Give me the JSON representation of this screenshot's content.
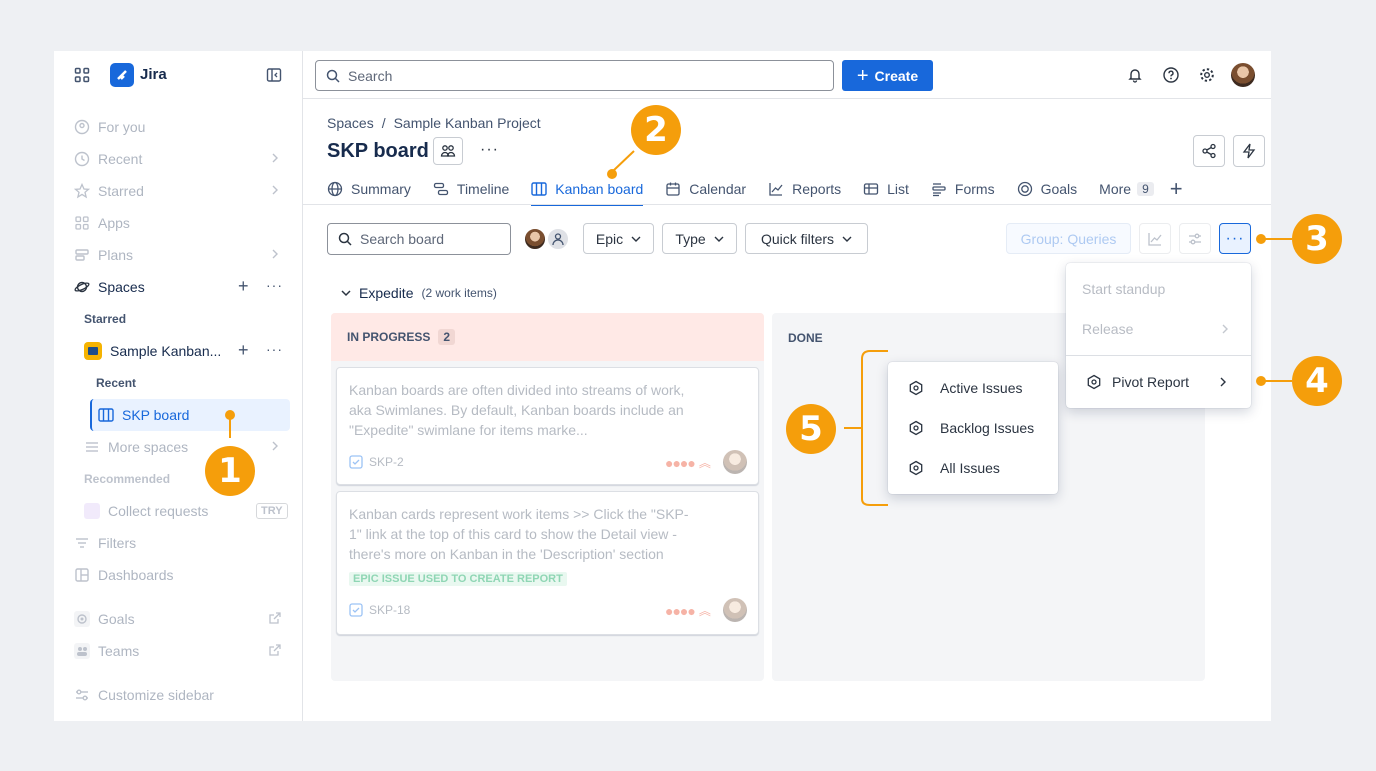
{
  "sidebar": {
    "app_name": "Jira",
    "items": [
      {
        "label": "For you"
      },
      {
        "label": "Recent"
      },
      {
        "label": "Starred"
      },
      {
        "label": "Apps"
      },
      {
        "label": "Plans"
      }
    ],
    "spaces_label": "Spaces",
    "starred_label": "Starred",
    "project_name": "Sample Kanban...",
    "recent_label": "Recent",
    "current_board": "SKP board",
    "more_spaces": "More spaces",
    "recommended_label": "Recommended",
    "collect_requests": "Collect requests",
    "try_badge": "TRY",
    "filters": "Filters",
    "dashboards": "Dashboards",
    "goals": "Goals",
    "teams": "Teams",
    "customize": "Customize sidebar"
  },
  "topbar": {
    "search_placeholder": "Search",
    "create_label": "Create"
  },
  "header": {
    "breadcrumb_spaces": "Spaces",
    "breadcrumb_sep": "/",
    "breadcrumb_project": "Sample Kanban Project",
    "title": "SKP board",
    "more": "···"
  },
  "tabs": [
    {
      "label": "Summary",
      "icon": "globe-icon"
    },
    {
      "label": "Timeline",
      "icon": "timeline-icon"
    },
    {
      "label": "Kanban board",
      "icon": "board-icon"
    },
    {
      "label": "Calendar",
      "icon": "calendar-icon"
    },
    {
      "label": "Reports",
      "icon": "chart-icon"
    },
    {
      "label": "List",
      "icon": "list-icon"
    },
    {
      "label": "Forms",
      "icon": "forms-icon"
    },
    {
      "label": "Goals",
      "icon": "target-icon"
    }
  ],
  "tabs_more": {
    "label": "More",
    "count": "9"
  },
  "toolbar": {
    "search_board_placeholder": "Search board",
    "epic": "Epic",
    "type": "Type",
    "quick_filters": "Quick filters",
    "group": "Group: Queries"
  },
  "swimlane": {
    "name": "Expedite",
    "count": "(2 work items)"
  },
  "columns": {
    "in_progress": {
      "label": "IN PROGRESS",
      "count": "2"
    },
    "done": {
      "label": "DONE"
    }
  },
  "cards": [
    {
      "text": "Kanban boards are often divided into streams of work, aka Swimlanes. By default, Kanban boards include an \"Expedite\" swimlane for items marke...",
      "key": "SKP-2"
    },
    {
      "text": "Kanban cards represent work items >> Click the \"SKP-1\" link at the top of this card to show the Detail view - there's more on Kanban in the 'Description' section",
      "epic": "EPIC ISSUE USED TO CREATE REPORT",
      "key": "SKP-18"
    }
  ],
  "more_menu": {
    "start_standup": "Start standup",
    "release": "Release",
    "pivot_report": "Pivot Report"
  },
  "submenu": [
    "Active Issues",
    "Backlog Issues",
    "All Issues"
  ],
  "callouts": [
    "1",
    "2",
    "3",
    "4",
    "5"
  ],
  "colors": {
    "accent": "#1868db",
    "callout": "#f59e0b",
    "inprogress_bg": "#ffe9e6"
  }
}
